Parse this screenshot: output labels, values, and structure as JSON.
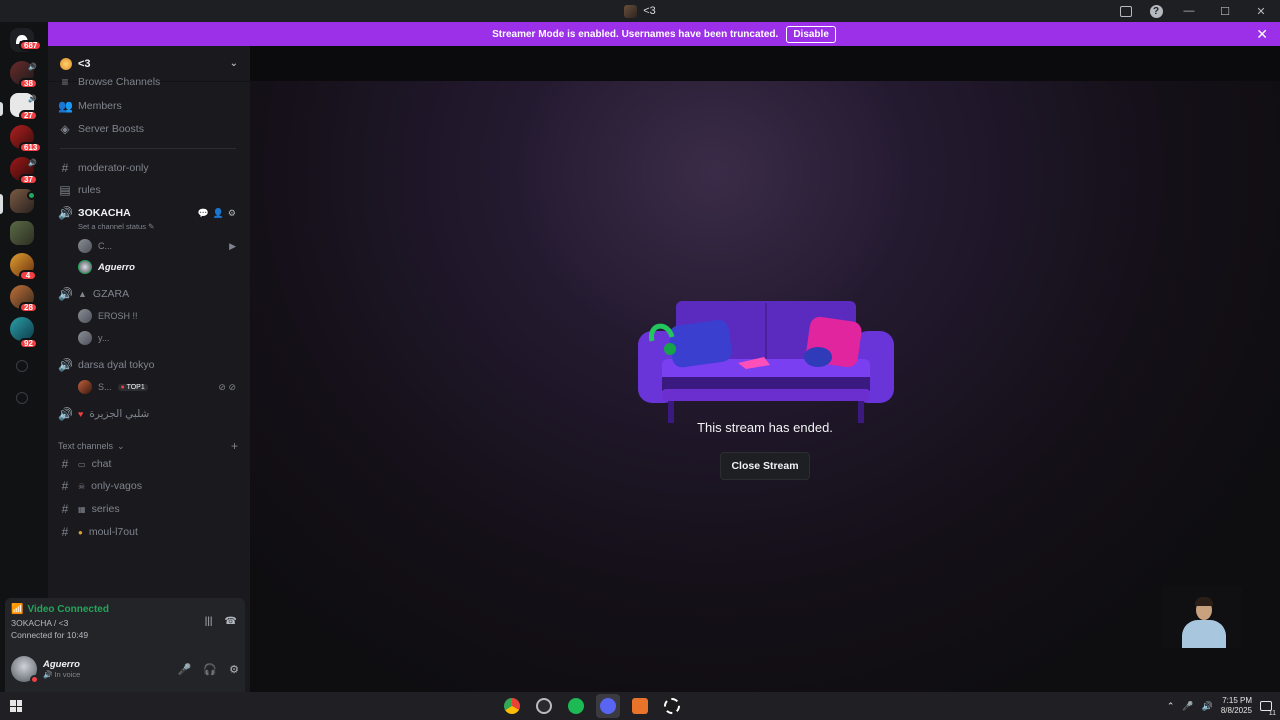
{
  "window": {
    "title": "<3"
  },
  "banner": {
    "text": "Streamer Mode is enabled. Usernames have been truncated.",
    "disable_label": "Disable"
  },
  "servers": [
    {
      "badge": "687"
    },
    {
      "badge": "38"
    },
    {
      "badge": "27"
    },
    {
      "badge": "613"
    },
    {
      "badge": "37"
    },
    {
      "badge": ""
    },
    {
      "badge": ""
    },
    {
      "badge": "4"
    },
    {
      "badge": "28"
    },
    {
      "badge": "92"
    }
  ],
  "guild": {
    "name": "<3"
  },
  "sidebar": {
    "browse_channels": "Browse Channels",
    "members": "Members",
    "server_boosts": "Server Boosts",
    "channels": {
      "moderator_only": "moderator-only",
      "rules": "rules",
      "active_voice": "ЗOKACHA",
      "channel_status": "Set a channel status",
      "active_users": [
        "C...",
        "Aguerro"
      ],
      "gzara": "GZARA",
      "gzara_users": [
        "EROSH !!",
        "y..."
      ],
      "darsa": "darsa dyal tokyo",
      "darsa_user": "S...",
      "darsa_badge": "TOP1",
      "arabic": "شلبي الجزيرة"
    },
    "text_category": "Text channels",
    "text_channels": {
      "chat": "chat",
      "only_vagos": "only-vagos",
      "series": "series",
      "moul": "moul-l7out"
    }
  },
  "voice_panel": {
    "status": "Video Connected",
    "channel": "ЗOKACHA / <3",
    "connected_for_label": "Connected for",
    "connected_time": "10:49"
  },
  "user_panel": {
    "name": "Aguerro",
    "sub": "In voice"
  },
  "stage": {
    "ended_text": "This stream has ended.",
    "close_label": "Close Stream"
  },
  "taskbar": {
    "time": "7:15 PM",
    "date": "8/8/2025",
    "notif_count": "11"
  },
  "colors": {
    "banner": "#9b30e8",
    "voice_connected": "#23a55a",
    "badge_red": "#f23f43"
  }
}
